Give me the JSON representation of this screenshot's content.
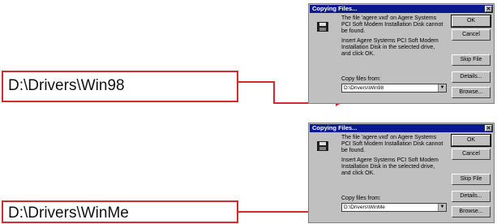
{
  "callouts": [
    {
      "text": "D:\\Drivers\\Win98"
    },
    {
      "text": "D:\\Drivers\\WinMe"
    }
  ],
  "dialogs": [
    {
      "title": "Copying Files...",
      "message1": "The file 'agere.vxd' on Agere Systems PCI Soft Modem Installation Disk cannot be found.",
      "message2": "Insert Agere Systems PCI Soft Modem Installation Disk in the selected drive, and click OK.",
      "ok_label": "OK",
      "cancel_label": "Cancel",
      "skip_label": "Skip File",
      "details_label": "Details...",
      "browse_label": "Browse...",
      "copy_from_label": "Copy files from:",
      "copy_from_value": "D:\\Drivers\\Win98"
    },
    {
      "title": "Copying Files...",
      "message1": "The file 'agere.vxd' on Agere Systems PCI Soft Modem Installation Disk cannot be found.",
      "message2": "Insert Agere Systems PCI Soft Modem Installation Disk in the selected drive, and click OK.",
      "ok_label": "OK",
      "cancel_label": "Cancel",
      "skip_label": "Skip File",
      "details_label": "Details...",
      "browse_label": "Browse...",
      "copy_from_label": "Copy files from:",
      "copy_from_value": "D:\\Drivers\\WinMe"
    }
  ],
  "colors": {
    "callout_border": "#d42a2a",
    "titlebar": "#0a1a8c",
    "dialog_face": "#c0c0c0"
  }
}
